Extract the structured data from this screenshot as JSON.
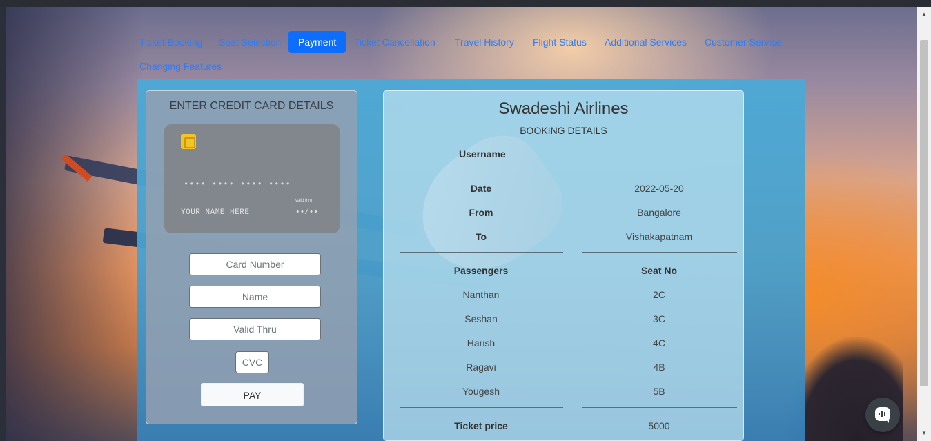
{
  "nav": {
    "tabs": [
      {
        "label": "Ticket Booking",
        "active": false
      },
      {
        "label": "Seat Selection",
        "active": false
      },
      {
        "label": "Payment",
        "active": true
      },
      {
        "label": "Ticket Cancellation",
        "active": false
      },
      {
        "label": "Travel History",
        "active": false
      },
      {
        "label": "Flight Status",
        "active": false
      },
      {
        "label": "Additional Services",
        "active": false
      },
      {
        "label": "Customer Service",
        "active": false
      }
    ],
    "second_row": "Changing Features"
  },
  "credit_card": {
    "heading": "ENTER CREDIT CARD DETAILS",
    "preview": {
      "number": "•••• •••• •••• ••••",
      "name": "YOUR NAME HERE",
      "valid_label": "valid thru",
      "expiry": "••/••"
    },
    "fields": {
      "card_number_placeholder": "Card Number",
      "name_placeholder": "Name",
      "valid_thru_placeholder": "Valid Thru",
      "cvc_placeholder": "CVC"
    },
    "pay_label": "PAY"
  },
  "booking": {
    "airline": "Swadeshi Airlines",
    "subtitle": "BOOKING DETAILS",
    "username_label": "Username",
    "username_value": "",
    "date_label": "Date",
    "date_value": "2022-05-20",
    "from_label": "From",
    "from_value": "Bangalore",
    "to_label": "To",
    "to_value": "Vishakapatnam",
    "passengers_header": "Passengers",
    "seat_header": "Seat No",
    "passengers": [
      {
        "name": "Nanthan",
        "seat": "2C"
      },
      {
        "name": "Seshan",
        "seat": "3C"
      },
      {
        "name": "Harish",
        "seat": "4C"
      },
      {
        "name": "Ragavi",
        "seat": "4B"
      },
      {
        "name": "Yougesh",
        "seat": "5B"
      }
    ],
    "price_label": "Ticket price",
    "price_value": "5000"
  },
  "icons": {
    "chip": "card-chip-icon",
    "chat": "chat-icon"
  },
  "colors": {
    "accent": "#0d6efd",
    "link": "#2e7df7"
  }
}
